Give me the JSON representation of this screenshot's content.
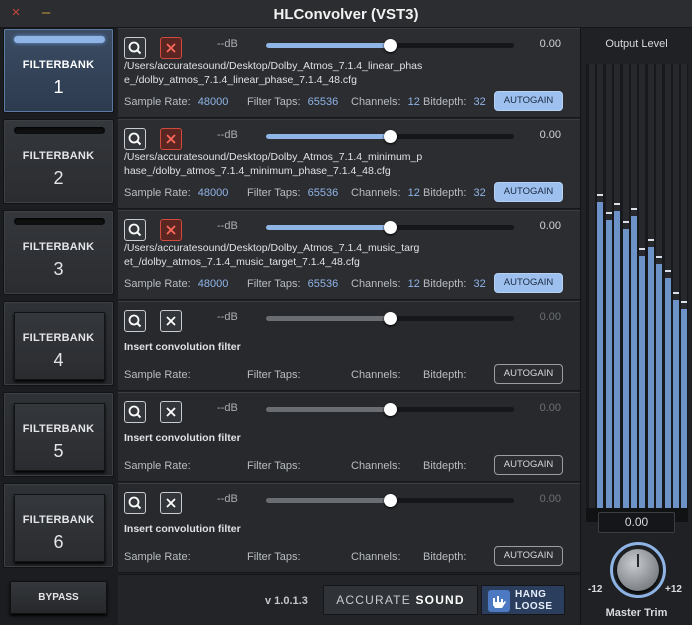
{
  "window": {
    "title": "HLConvolver (VST3)",
    "close_icon": "×",
    "minimize_icon": "–"
  },
  "filterbanks": [
    {
      "label": "FILTERBANK",
      "number": "1",
      "state": "active"
    },
    {
      "label": "FILTERBANK",
      "number": "2",
      "state": "loaded"
    },
    {
      "label": "FILTERBANK",
      "number": "3",
      "state": "loaded"
    },
    {
      "label": "FILTERBANK",
      "number": "4",
      "state": "empty"
    },
    {
      "label": "FILTERBANK",
      "number": "5",
      "state": "empty"
    },
    {
      "label": "FILTERBANK",
      "number": "6",
      "state": "empty"
    }
  ],
  "bypass_label": "BYPASS",
  "rows": [
    {
      "db_label": "--dB",
      "gain_value": "0.00",
      "gain_level": 0.5,
      "path": "/Users/accuratesound/Desktop/Dolby_Atmos_7.1.4_linear_phase_/dolby_atmos_7.1.4_linear_phase_7.1.4_48.cfg",
      "sample_rate_label": "Sample Rate:",
      "sample_rate": "48000",
      "filter_taps_label": "Filter Taps:",
      "filter_taps": "65536",
      "channels_label": "Channels:",
      "channels": "12",
      "bitdepth_label": "Bitdepth:",
      "bitdepth": "32",
      "autogain_label": "AUTOGAIN",
      "autogain_on": true,
      "loaded": true
    },
    {
      "db_label": "--dB",
      "gain_value": "0.00",
      "gain_level": 0.5,
      "path": "/Users/accuratesound/Desktop/Dolby_Atmos_7.1.4_minimum_phase_/dolby_atmos_7.1.4_minimum_phase_7.1.4_48.cfg",
      "sample_rate_label": "Sample Rate:",
      "sample_rate": "48000",
      "filter_taps_label": "Filter Taps:",
      "filter_taps": "65536",
      "channels_label": "Channels:",
      "channels": "12",
      "bitdepth_label": "Bitdepth:",
      "bitdepth": "32",
      "autogain_label": "AUTOGAIN",
      "autogain_on": true,
      "loaded": true
    },
    {
      "db_label": "--dB",
      "gain_value": "0.00",
      "gain_level": 0.5,
      "path": "/Users/accuratesound/Desktop/Dolby_Atmos_7.1.4_music_target_/dolby_atmos_7.1.4_music_target_7.1.4_48.cfg",
      "sample_rate_label": "Sample Rate:",
      "sample_rate": "48000",
      "filter_taps_label": "Filter Taps:",
      "filter_taps": "65536",
      "channels_label": "Channels:",
      "channels": "12",
      "bitdepth_label": "Bitdepth:",
      "bitdepth": "32",
      "autogain_label": "AUTOGAIN",
      "autogain_on": true,
      "loaded": true
    },
    {
      "db_label": "--dB",
      "gain_value": "0.00",
      "gain_level": 0.5,
      "path": "Insert convolution filter",
      "sample_rate_label": "Sample Rate:",
      "sample_rate": "",
      "filter_taps_label": "Filter Taps:",
      "filter_taps": "",
      "channels_label": "Channels:",
      "channels": "",
      "bitdepth_label": "Bitdepth:",
      "bitdepth": "",
      "autogain_label": "AUTOGAIN",
      "autogain_on": false,
      "loaded": false
    },
    {
      "db_label": "--dB",
      "gain_value": "0.00",
      "gain_level": 0.5,
      "path": "Insert convolution filter",
      "sample_rate_label": "Sample Rate:",
      "sample_rate": "",
      "filter_taps_label": "Filter Taps:",
      "filter_taps": "",
      "channels_label": "Channels:",
      "channels": "",
      "bitdepth_label": "Bitdepth:",
      "bitdepth": "",
      "autogain_label": "AUTOGAIN",
      "autogain_on": false,
      "loaded": false
    },
    {
      "db_label": "--dB",
      "gain_value": "0.00",
      "gain_level": 0.5,
      "path": "Insert convolution filter",
      "sample_rate_label": "Sample Rate:",
      "sample_rate": "",
      "filter_taps_label": "Filter Taps:",
      "filter_taps": "",
      "channels_label": "Channels:",
      "channels": "",
      "bitdepth_label": "Bitdepth:",
      "bitdepth": "",
      "autogain_label": "AUTOGAIN",
      "autogain_on": false,
      "loaded": false
    }
  ],
  "footer": {
    "version": "v 1.0.1.3",
    "brand_light": "ACCURATE",
    "brand_bold": "SOUND",
    "logo_line1": "HANG",
    "logo_line2": "LOOSE"
  },
  "output": {
    "title": "Output Level",
    "meter_levels": [
      0.0,
      0.72,
      0.68,
      0.7,
      0.66,
      0.69,
      0.6,
      0.62,
      0.58,
      0.55,
      0.5,
      0.48
    ],
    "master_trim_value": "0.00",
    "master_trim_label": "Master Trim",
    "trim_min": "-12",
    "trim_max": "+12",
    "accent_color": "#8fb4e6"
  }
}
